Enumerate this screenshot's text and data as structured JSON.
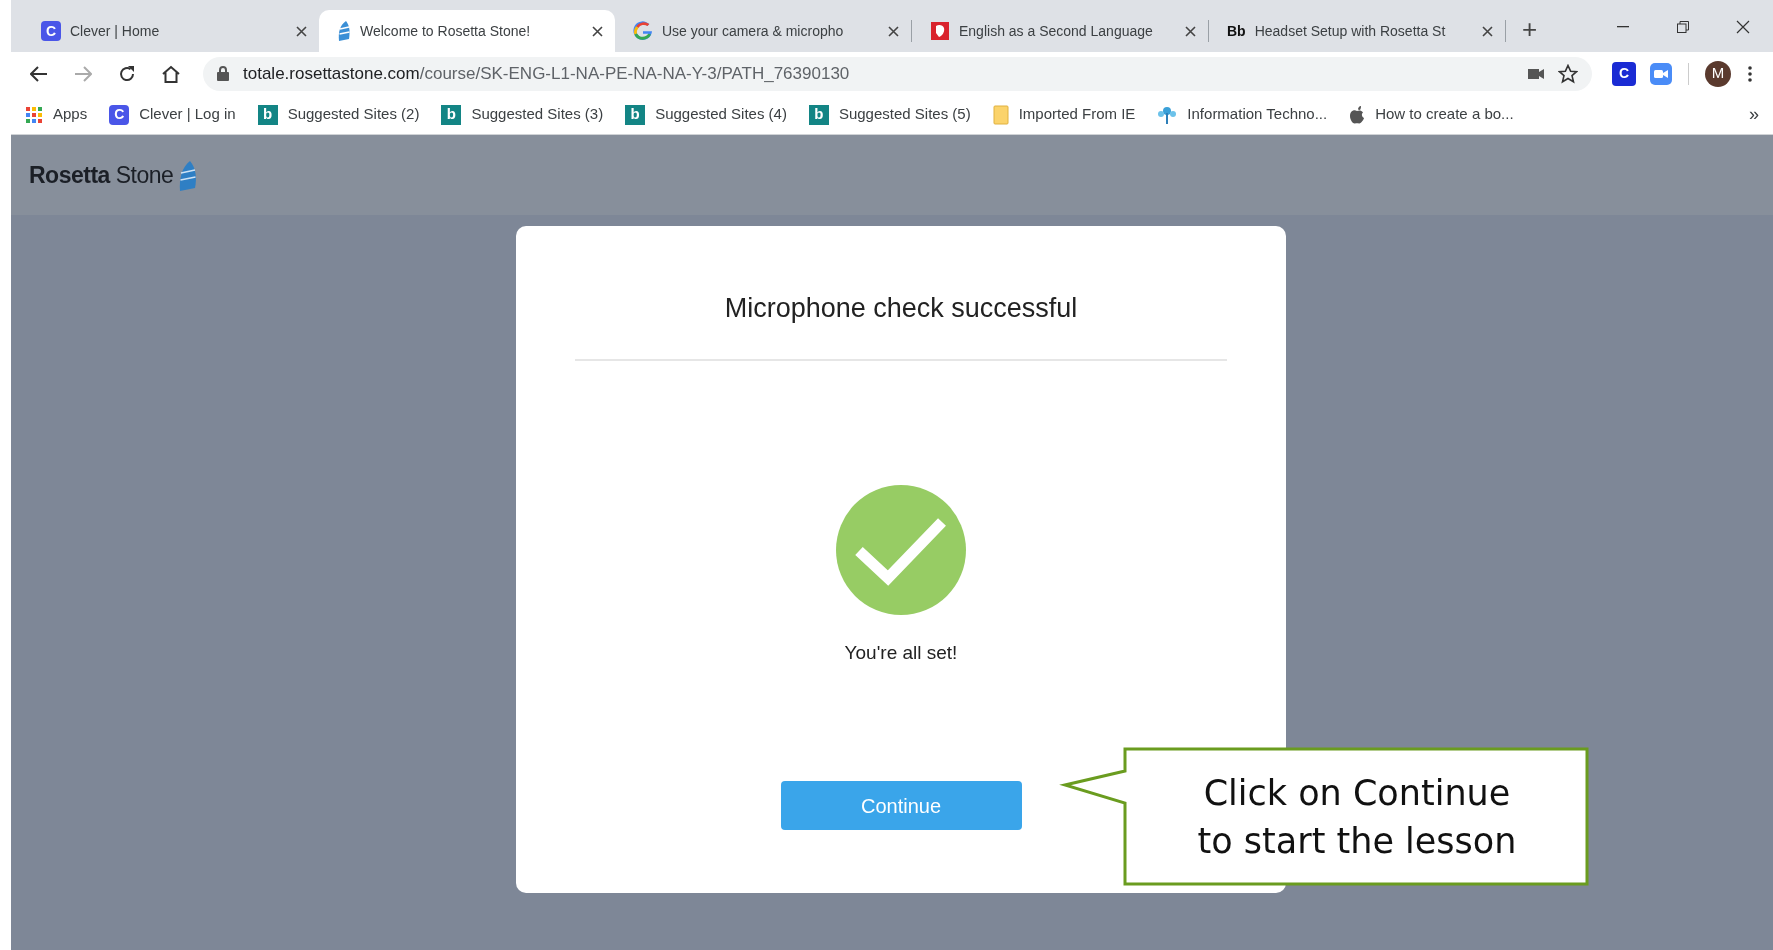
{
  "browser": {
    "tabs": [
      {
        "label": "Clever | Home",
        "selected": false,
        "kind": "letter",
        "icon_text": "C"
      },
      {
        "label": "Welcome to Rosetta Stone!",
        "selected": true,
        "kind": "sail"
      },
      {
        "label": "Use your camera & micropho",
        "selected": false,
        "kind": "g"
      },
      {
        "label": "English as a Second Language",
        "selected": false,
        "kind": "page"
      },
      {
        "label": "Headset Setup with Rosetta St",
        "selected": false,
        "kind": "text",
        "icon_text": "Bb"
      }
    ],
    "new_tab": "+",
    "address": {
      "host": "totale.rosettastone.com",
      "path": "/course/SK-ENG-L1-NA-PE-NA-NA-Y-3/PATH_76390130"
    },
    "extension_letter": "C",
    "profile_letter": "M",
    "bookmarks": [
      {
        "label": "Apps",
        "kind": "grid"
      },
      {
        "label": "Clever | Log in",
        "kind": "letter",
        "icon_text": "C"
      },
      {
        "label": "Suggested Sites (2)",
        "kind": "b",
        "icon_text": "b"
      },
      {
        "label": "Suggested Sites (3)",
        "kind": "b",
        "icon_text": "b"
      },
      {
        "label": "Suggested Sites (4)",
        "kind": "b",
        "icon_text": "b"
      },
      {
        "label": "Suggested Sites (5)",
        "kind": "b",
        "icon_text": "b"
      },
      {
        "label": "Imported From IE",
        "kind": "folder"
      },
      {
        "label": "Information Techno...",
        "kind": "tree"
      },
      {
        "label": "How to create a bo...",
        "kind": "apple"
      }
    ],
    "more": "»"
  },
  "page": {
    "logo": {
      "word_1": "Rosetta",
      "word_2": "Stone"
    },
    "dialog": {
      "title": "Microphone check successful",
      "message": "You're all set!",
      "button": "Continue"
    },
    "callout": {
      "lines": [
        "Click on Continue",
        "to start the lesson"
      ]
    }
  }
}
